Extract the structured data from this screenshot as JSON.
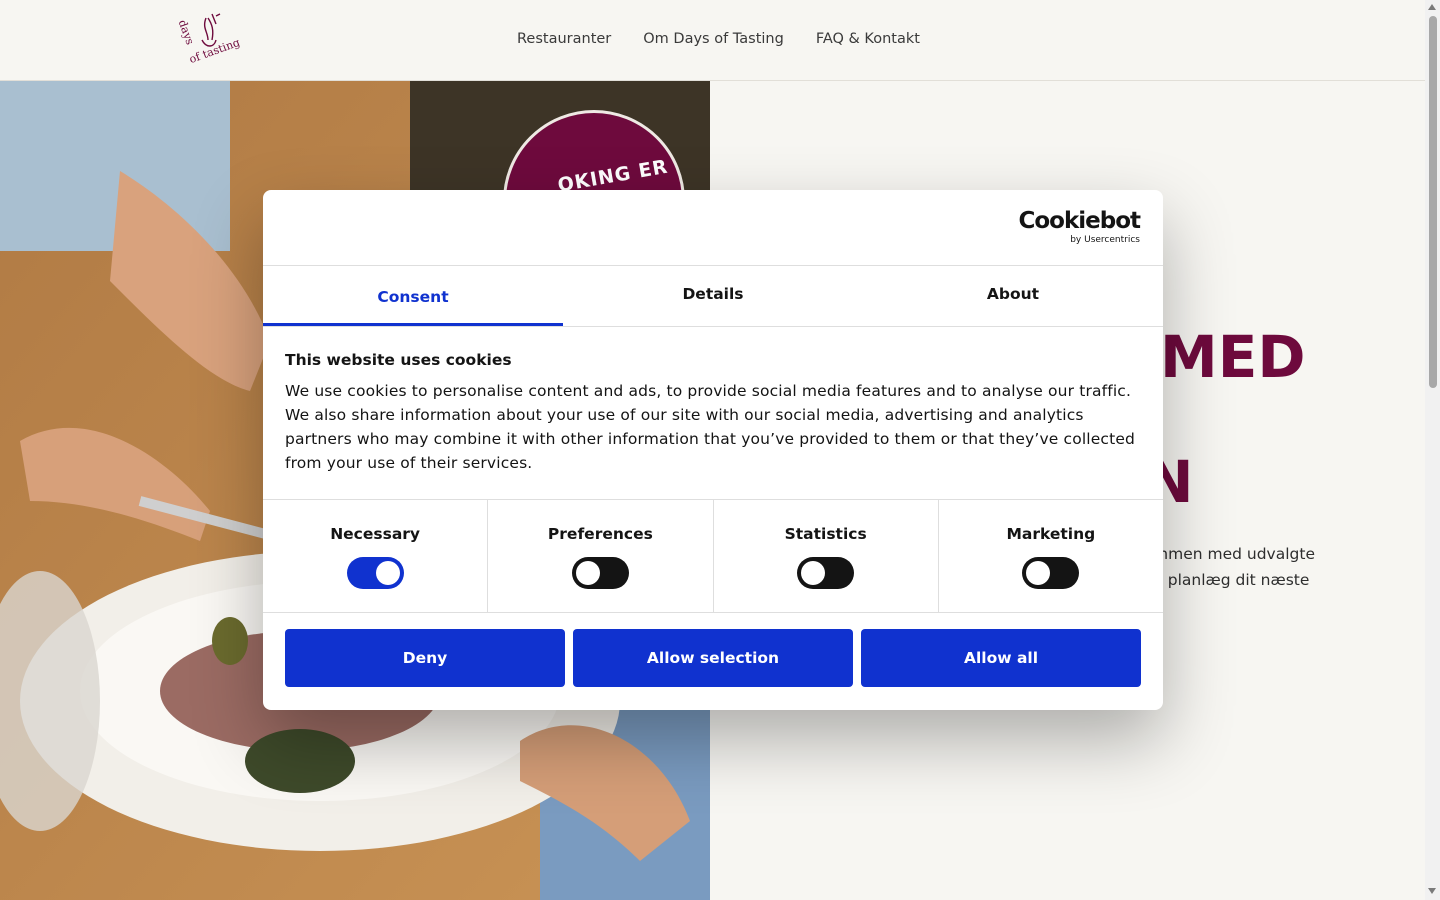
{
  "header": {
    "logo_text": "days of tasting",
    "nav": [
      "Restauranter",
      "Om Days of Tasting",
      "FAQ & Kontakt"
    ]
  },
  "hero": {
    "badge_text": "OKING ER",
    "title_line1": "MED",
    "title_line2": "N",
    "text_line1": "mmen med udvalgte",
    "text_line2": "g planlæg dit næste"
  },
  "cookie": {
    "brand": "Cookiebot",
    "brand_sub": "by Usercentrics",
    "tabs": [
      "Consent",
      "Details",
      "About"
    ],
    "active_tab": "Consent",
    "heading": "This website uses cookies",
    "body": "We use cookies to personalise content and ads, to provide social media features and to analyse our traffic. We also share information about your use of our site with our social media, advertising and analytics partners who may combine it with other information that you’ve provided to them or that they’ve collected from your use of their services.",
    "toggles": [
      {
        "label": "Necessary",
        "on": true
      },
      {
        "label": "Preferences",
        "on": false
      },
      {
        "label": "Statistics",
        "on": false
      },
      {
        "label": "Marketing",
        "on": false
      }
    ],
    "buttons": {
      "deny": "Deny",
      "selection": "Allow selection",
      "all": "Allow all"
    }
  },
  "colors": {
    "accent": "#1032cf",
    "brand_wine": "#6e0a3d",
    "page_bg": "#f7f6f2"
  }
}
